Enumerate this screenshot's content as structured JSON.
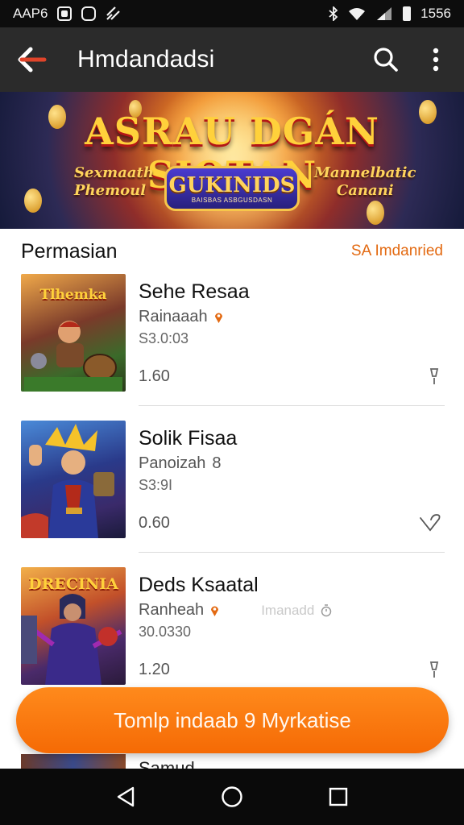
{
  "status_bar": {
    "left_text": "AAP6",
    "time": "1556"
  },
  "app_bar": {
    "title": "Hmdandadsi",
    "back_icon": "back-arrow-icon",
    "search_icon": "search-icon",
    "menu_icon": "more-vert-icon"
  },
  "banner": {
    "title": "ASRAU DGÁN SIOTAN",
    "left_text_1": "Sexmaath",
    "left_text_2": "Phemoul",
    "badge_main": "GUKINIDS",
    "badge_sub": "BAISBAS ASBGUSDASN",
    "right_text_1": "Mannelbatic",
    "right_text_2": "Canani"
  },
  "section": {
    "title": "Permasian",
    "link": "SA Imdanried"
  },
  "items": [
    {
      "thumb_label": "Tlhemka",
      "name": "Sehe Resaa",
      "sub": "Rainaaah",
      "price": "S3.0:03",
      "meta": "1.60",
      "icon": "location-pin-icon",
      "action_icon": "pin-outline-icon"
    },
    {
      "thumb_label": "",
      "name": "Solik Fisaa",
      "sub": "Panoizah",
      "sub_suffix": "8",
      "price": "S3:9I",
      "meta": "0.60",
      "action_icon": "heart-outline-icon"
    },
    {
      "thumb_label": "DRECINIA",
      "name": "Deds Ksaatal",
      "sub": "Ranheah",
      "sub_faded": "Imanadd",
      "price": "30.0330",
      "meta": "1.20",
      "icon": "location-pin-icon",
      "action_icon": "pin-outline-icon"
    }
  ],
  "peek_item": {
    "name": "Samud"
  },
  "fab": {
    "label": "Tomlp indaab 9 Myrkatise"
  },
  "nav": {
    "back": "nav-back-icon",
    "home": "nav-home-icon",
    "recents": "nav-recents-icon"
  },
  "colors": {
    "accent": "#f56a05",
    "app_bar": "#2b2b2b",
    "status_bar": "#0d0d0d"
  }
}
